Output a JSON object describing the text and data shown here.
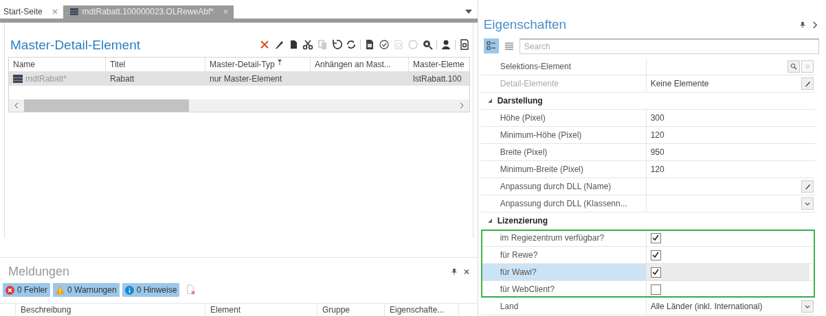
{
  "tabs": [
    {
      "label": "Start-Seite",
      "selected": false
    },
    {
      "label": "mdtRabatt.100000023.OLReweAbf*",
      "selected": true
    }
  ],
  "document": {
    "title": "Master-Detail-Element",
    "table": {
      "columns": [
        {
          "label": "Name",
          "filter": false
        },
        {
          "label": "Titel",
          "filter": false
        },
        {
          "label": "Master-Detail-Typ",
          "filter": true
        },
        {
          "label": "Anhängen an Mast...",
          "filter": false
        },
        {
          "label": "Master-Eleme",
          "filter": false
        }
      ],
      "rows": [
        {
          "selected": true,
          "cells": [
            {
              "text": "mdtRabatt*",
              "muted": true
            },
            {
              "text": "Rabatt",
              "muted": false
            },
            {
              "text": "nur Master-Element",
              "muted": false
            },
            {
              "text": ""
            },
            {
              "text": "lstRabatt.100",
              "muted": false
            }
          ]
        }
      ]
    }
  },
  "messages": {
    "title": "Meldungen",
    "filters": [
      {
        "kind": "error",
        "label": "0 Fehler",
        "selected": true
      },
      {
        "kind": "warning",
        "label": "0 Warnungen",
        "selected": true
      },
      {
        "kind": "info",
        "label": "0 Hinweise",
        "selected": true
      }
    ],
    "columns": [
      "Beschreibung",
      "Element",
      "Gruppe",
      "Eigenschafte..."
    ]
  },
  "properties": {
    "title": "Eigenschaften",
    "search": {
      "placeholder": "Search"
    },
    "view_modes": [
      {
        "kind": "categorized",
        "selected": true
      },
      {
        "kind": "alphabetical",
        "selected": false
      }
    ],
    "rows": [
      {
        "kind": "text",
        "label": "Selektions-Element",
        "value": "",
        "editors": [
          {
            "kind": "search",
            "disabled": false
          },
          {
            "kind": "forward",
            "disabled": true
          }
        ],
        "disabled": false,
        "selected": false,
        "highlighted": false
      },
      {
        "kind": "text",
        "label": "Detail-Elemente",
        "value": "Keine Elemente",
        "editors": [
          {
            "kind": "edit",
            "disabled": false
          }
        ],
        "disabled": true,
        "selected": false,
        "highlighted": false
      },
      {
        "kind": "section",
        "label": "Darstellung",
        "expanded": true
      },
      {
        "kind": "text",
        "label": "Höhe (Pixel)",
        "value": "300",
        "disabled": false,
        "selected": false,
        "highlighted": false
      },
      {
        "kind": "text",
        "label": "Minimum-Höhe (Pixel)",
        "value": "120",
        "disabled": false,
        "selected": false,
        "highlighted": false
      },
      {
        "kind": "text",
        "label": "Breite (Pixel)",
        "value": "950",
        "disabled": false,
        "selected": false,
        "highlighted": false
      },
      {
        "kind": "text",
        "label": "Minimum-Breite (Pixel)",
        "value": "120",
        "disabled": false,
        "selected": false,
        "highlighted": false
      },
      {
        "kind": "text",
        "label": "Anpassung durch DLL (Name)",
        "value": "",
        "editors": [
          {
            "kind": "edit",
            "disabled": false
          }
        ],
        "disabled": false,
        "selected": false,
        "highlighted": false
      },
      {
        "kind": "text",
        "label": "Anpassung durch DLL (Klassenn...",
        "value": "",
        "editors": [
          {
            "kind": "dropdown",
            "disabled": false
          }
        ],
        "disabled": false,
        "selected": false,
        "highlighted": false
      },
      {
        "kind": "section",
        "label": "Lizenzierung",
        "expanded": true
      },
      {
        "kind": "checkbox",
        "label": "im Regiezentrum verfügbar?",
        "checked": true,
        "selected": false,
        "highlighted": true
      },
      {
        "kind": "checkbox",
        "label": "für Rewe?",
        "checked": true,
        "selected": false,
        "highlighted": true
      },
      {
        "kind": "checkbox",
        "label": "für Wawi?",
        "checked": true,
        "selected": true,
        "highlighted": true
      },
      {
        "kind": "checkbox",
        "label": "für WebClient?",
        "checked": false,
        "selected": false,
        "highlighted": true
      },
      {
        "kind": "text",
        "label": "Land",
        "value": "Alle Länder (inkl. International)",
        "editors": [
          {
            "kind": "dropdown",
            "disabled": false
          }
        ],
        "disabled": false,
        "selected": false,
        "highlighted": false
      }
    ]
  }
}
